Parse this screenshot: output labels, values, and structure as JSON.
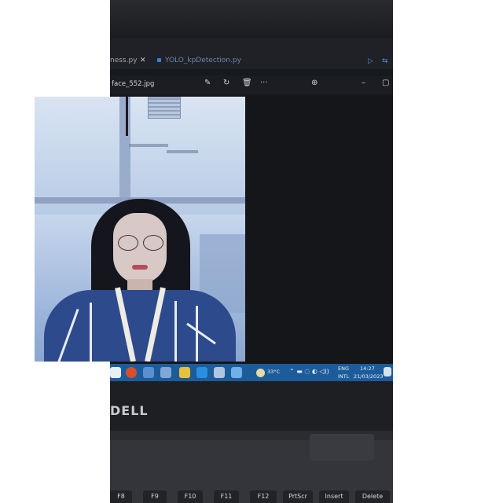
{
  "editor": {
    "tab_left_fragment": "ness.py",
    "tab_left_close": "✕",
    "tab_right": "YOLO_kpDetection.py"
  },
  "viewer": {
    "filename": "face_552.jpg",
    "tools": [
      "edit-icon",
      "rotate-icon",
      "delete-icon",
      "more-icon",
      "zoom-icon",
      "minimize-icon",
      "maximize-icon"
    ],
    "more_glyph": "···"
  },
  "taskbar": {
    "weather": "33°C",
    "language": "ENG",
    "keyboard": "INTL",
    "time": "14:27",
    "date": "21/03/2023"
  },
  "laptop": {
    "brand": "DELL",
    "keys": [
      "F8",
      "F9",
      "F10",
      "F11",
      "F12",
      "PrtScr",
      "Insert",
      "Delete"
    ]
  },
  "colors": {
    "taskbar": "#1c5c9a",
    "sweater": "#2c4a8c",
    "sky": "#b3c8e6"
  }
}
